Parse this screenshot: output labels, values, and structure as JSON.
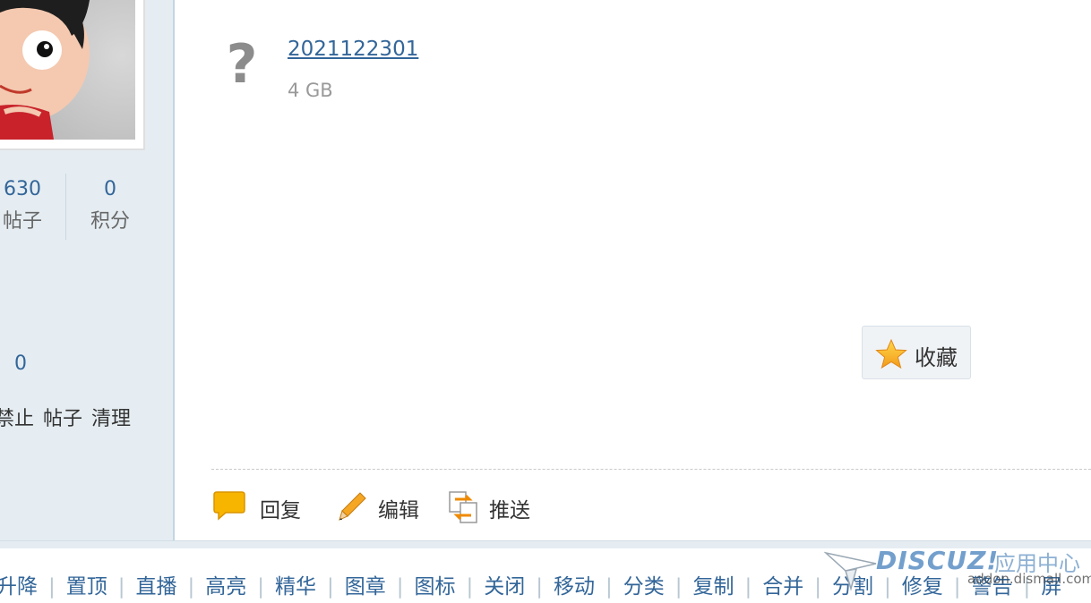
{
  "sidebar": {
    "stats": [
      {
        "value": "630",
        "label": "帖子"
      },
      {
        "value": "0",
        "label": "积分"
      }
    ],
    "count": "0",
    "actions": [
      "禁止",
      "帖子",
      "清理"
    ]
  },
  "attachment": {
    "name": "2021122301",
    "size": "4 GB",
    "icon": "unknown-file-icon"
  },
  "favorite_button": {
    "label": "收藏",
    "icon": "star-icon"
  },
  "post_actions": [
    {
      "label": "回复",
      "icon": "reply-bubble-icon"
    },
    {
      "label": "编辑",
      "icon": "pencil-icon"
    },
    {
      "label": "推送",
      "icon": "push-icon"
    }
  ],
  "mod_bar": [
    "升降",
    "置顶",
    "直播",
    "高亮",
    "精华",
    "图章",
    "图标",
    "关闭",
    "移动",
    "分类",
    "复制",
    "合并",
    "分割",
    "修复",
    "警告",
    "屏"
  ],
  "watermark": {
    "logo": "DISCUZ!",
    "title": "应用中心",
    "url": "addon.dismall.com"
  },
  "colors": {
    "link": "#336699",
    "sidebar_bg": "#e5edf2",
    "sidebar_border": "#c2d5e3"
  }
}
